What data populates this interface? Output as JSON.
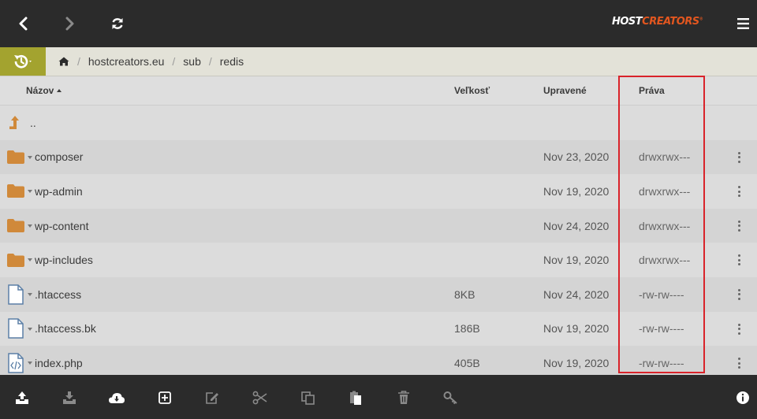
{
  "topbar": {
    "logo_host": "HOST",
    "logo_creators": "CREATORS",
    "logo_mark": "®",
    "back_icon": "chevron-left-icon",
    "forward_icon": "chevron-right-icon",
    "refresh_icon": "refresh-icon",
    "menu_icon": "hamburger-menu-icon"
  },
  "breadcrumb": {
    "history_icon": "history-icon",
    "home_icon": "home-icon",
    "items": [
      "hostcreators.eu",
      "sub",
      "redis"
    ],
    "separator": "/"
  },
  "columns": {
    "name": "Názov",
    "size": "Veľkosť",
    "modified": "Upravené",
    "permissions": "Práva",
    "name_sort": "ascending"
  },
  "parent_row": {
    "label": "..",
    "icon": "arrow-up-icon"
  },
  "files": [
    {
      "name": "composer",
      "type": "folder",
      "size": "",
      "modified": "Nov 23, 2020",
      "permissions": "drwxrwx---"
    },
    {
      "name": "wp-admin",
      "type": "folder",
      "size": "",
      "modified": "Nov 19, 2020",
      "permissions": "drwxrwx---"
    },
    {
      "name": "wp-content",
      "type": "folder",
      "size": "",
      "modified": "Nov 24, 2020",
      "permissions": "drwxrwx---"
    },
    {
      "name": "wp-includes",
      "type": "folder",
      "size": "",
      "modified": "Nov 19, 2020",
      "permissions": "drwxrwx---"
    },
    {
      "name": ".htaccess",
      "type": "file",
      "size": "8KB",
      "modified": "Nov 24, 2020",
      "permissions": "-rw-rw----"
    },
    {
      "name": ".htaccess.bk",
      "type": "file",
      "size": "186B",
      "modified": "Nov 19, 2020",
      "permissions": "-rw-rw----"
    },
    {
      "name": "index.php",
      "type": "code",
      "size": "405B",
      "modified": "Nov 19, 2020",
      "permissions": "-rw-rw----"
    }
  ],
  "toolbar": {
    "tools": [
      "upload-icon",
      "download-icon",
      "cloud-download-icon",
      "new-item-icon",
      "edit-icon",
      "cut-icon",
      "copy-icon",
      "paste-icon",
      "delete-icon",
      "permissions-key-icon"
    ],
    "info_icon": "info-icon"
  },
  "colors": {
    "topbar": "#2b2b2b",
    "accent_olive": "#a3a32f",
    "folder": "#d0893a",
    "file_icon": "#5b7fa6",
    "highlight_border": "#d9232a",
    "logo_orange": "#e2561f"
  }
}
